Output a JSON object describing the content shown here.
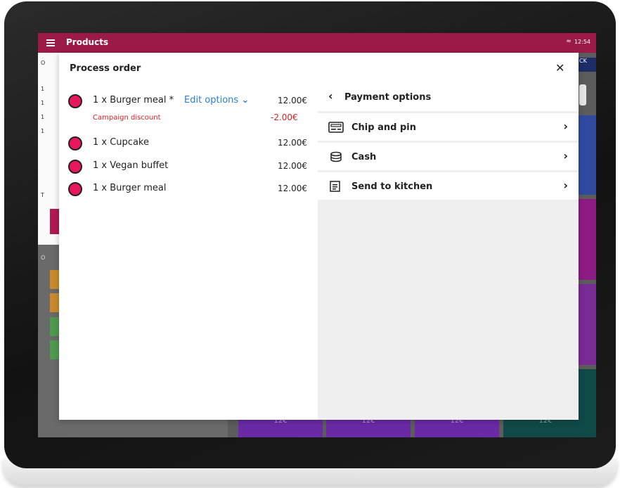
{
  "app_bar": {
    "title": "Products",
    "time": "12:54"
  },
  "background": {
    "top_right_button": "CK",
    "tile_label": "12€"
  },
  "modal": {
    "title": "Process order",
    "order_items": [
      {
        "label": "1 x Burger meal *",
        "price": "12.00€",
        "edit_label": "Edit options",
        "discount_label": "Campaign discount",
        "discount_price": "-2.00€"
      },
      {
        "label": "1 x Cupcake",
        "price": "12.00€"
      },
      {
        "label": "1 x Vegan buffet",
        "price": "12.00€"
      },
      {
        "label": "1 x Burger meal",
        "price": "12.00€"
      }
    ]
  },
  "payment": {
    "title": "Payment options",
    "options": [
      {
        "label": "Chip and pin",
        "icon": "card-reader-icon"
      },
      {
        "label": "Cash",
        "icon": "coins-icon"
      },
      {
        "label": "Send to kitchen",
        "icon": "receipt-icon"
      }
    ]
  },
  "colors": {
    "brand": "#9c1a48",
    "accent": "#e8175d",
    "link": "#2a7fd4",
    "discount": "#d42020"
  }
}
